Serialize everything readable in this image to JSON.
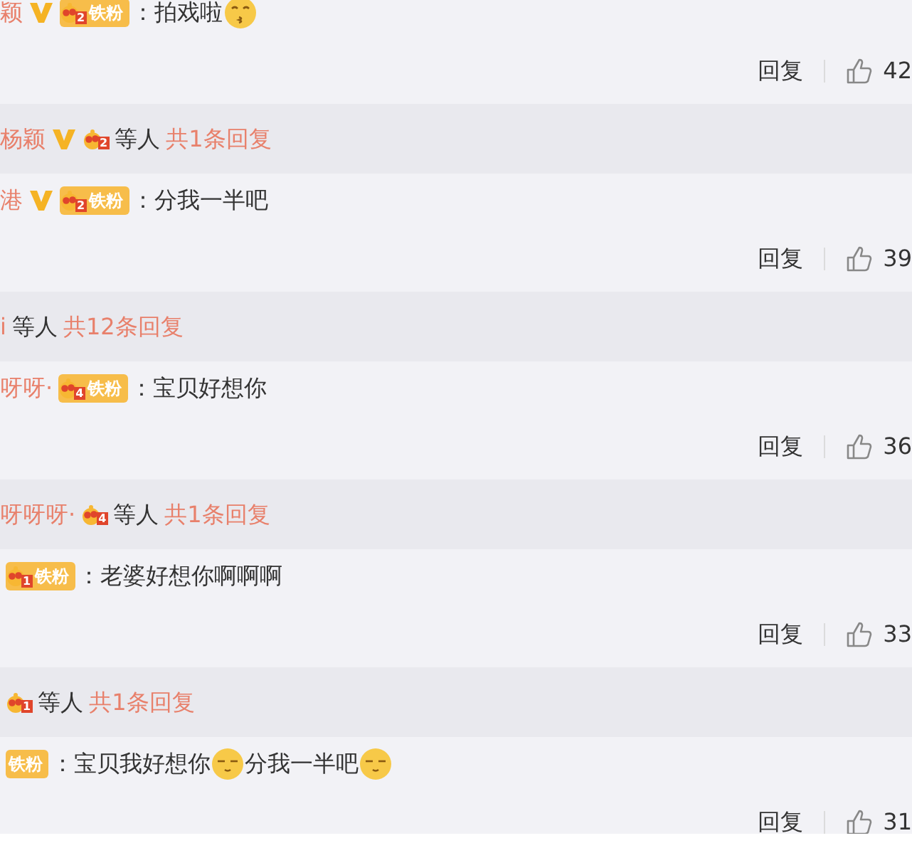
{
  "threads": [
    {
      "comment": {
        "name": "颖",
        "verified": true,
        "badge": {
          "level": "2",
          "label": "铁粉"
        },
        "separator": "：",
        "content": [
          {
            "kind": "text",
            "text": "拍戏啦"
          },
          {
            "kind": "kiss_emoji"
          }
        ],
        "reply": "回复",
        "likes": "42"
      },
      "summary": {
        "name": "杨颖",
        "verified": true,
        "badge": {
          "level": "2"
        },
        "others": "等人",
        "total": "共1条回复"
      }
    },
    {
      "comment": {
        "name": "港",
        "verified": true,
        "badge": {
          "level": "2",
          "label": "铁粉"
        },
        "separator": "：",
        "content": [
          {
            "kind": "text",
            "text": "分我一半吧"
          }
        ],
        "reply": "回复",
        "likes": "39"
      },
      "summary": {
        "name": "i",
        "verified": false,
        "others": "等人",
        "total": "共12条回复"
      }
    },
    {
      "comment": {
        "name": "呀呀·",
        "verified": false,
        "badge": {
          "level": "4",
          "label": "铁粉"
        },
        "separator": "：",
        "content": [
          {
            "kind": "text",
            "text": "宝贝好想你"
          }
        ],
        "reply": "回复",
        "likes": "36"
      },
      "summary": {
        "name": "呀呀呀·",
        "verified": false,
        "badge": {
          "level": "4"
        },
        "others": "等人",
        "total": "共1条回复"
      }
    },
    {
      "comment": {
        "verified": false,
        "badge": {
          "level": "1",
          "label": "铁粉"
        },
        "separator": "：",
        "content": [
          {
            "kind": "text",
            "text": "老婆好想你啊啊啊"
          }
        ],
        "reply": "回复",
        "likes": "33"
      },
      "summary": {
        "verified": false,
        "badge": {
          "level": "1"
        },
        "others": "等人",
        "total": "共1条回复"
      }
    },
    {
      "comment": {
        "verified": false,
        "badge": {
          "label": "铁粉"
        },
        "separator": "：",
        "content": [
          {
            "kind": "text",
            "text": "宝贝我好想你"
          },
          {
            "kind": "sleepy_emoji"
          },
          {
            "kind": "text",
            "text": "分我一半吧"
          },
          {
            "kind": "sleepy_emoji"
          }
        ],
        "reply": "回复",
        "likes": "31"
      }
    }
  ]
}
